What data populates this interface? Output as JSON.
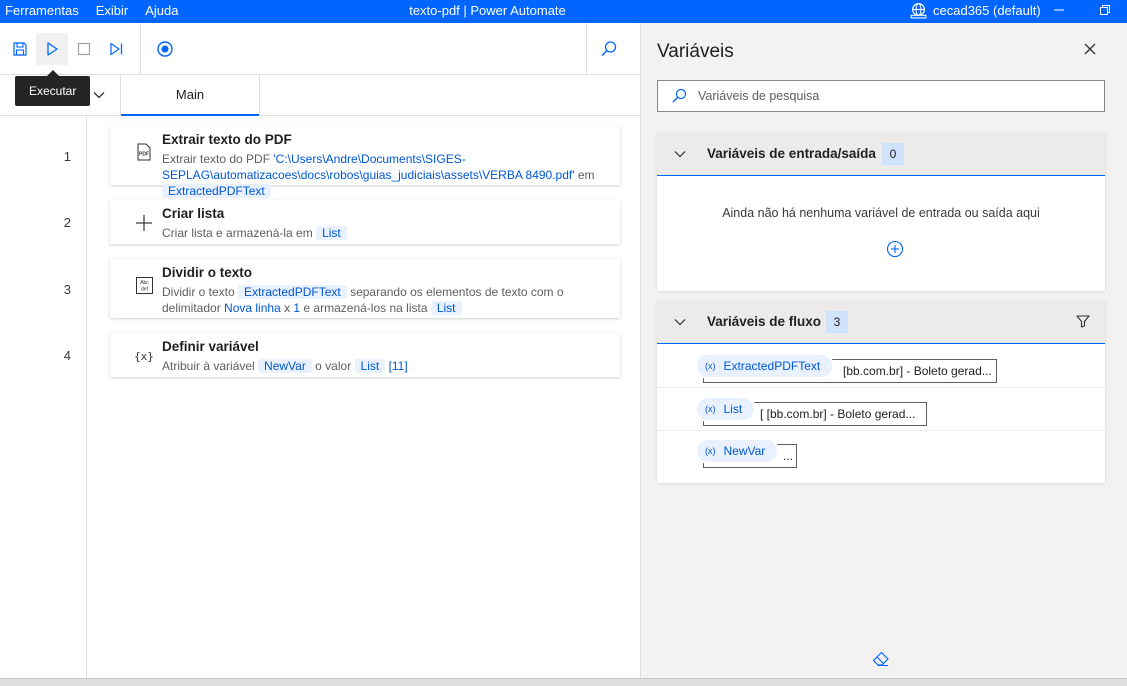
{
  "titlebar": {
    "menu": [
      "Ferramentas",
      "Exibir",
      "Ajuda"
    ],
    "title": "texto-pdf | Power Automate",
    "account": "cecad365 (default)"
  },
  "toolbar": {
    "tooltip": "Executar"
  },
  "tabs": {
    "main": "Main"
  },
  "actions": [
    {
      "line": "1",
      "title": "Extrair texto do PDF",
      "desc_prefix": "Extrair texto do PDF ",
      "path": "'C:\\Users\\Andre\\Documents\\SIGES-SEPLAG\\automatizacoes\\docs\\robos\\guias_judiciais\\assets\\VERBA 8490.pdf'",
      "desc_mid": " em ",
      "var": "ExtractedPDFText"
    },
    {
      "line": "2",
      "title": "Criar lista",
      "desc_prefix": "Criar lista e armazená-la em ",
      "var": "List"
    },
    {
      "line": "3",
      "title": "Dividir o texto",
      "desc_prefix": "Dividir o texto ",
      "var1": "ExtractedPDFText",
      "desc_mid1": " separando os elementos de texto com o delimitador ",
      "delim": "Nova linha",
      "desc_mid2": " x ",
      "count": "1",
      "desc_mid3": " e armazená-los na lista ",
      "var2": "List"
    },
    {
      "line": "4",
      "title": "Definir variável",
      "desc_prefix": "Atribuir à variável ",
      "var1": "NewVar",
      "desc_mid": " o valor ",
      "var2": "List",
      "index": "[11]"
    }
  ],
  "variables_panel": {
    "title": "Variáveis",
    "search_placeholder": "Variáveis de pesquisa",
    "io_section": {
      "title": "Variáveis de entrada/saída",
      "count": "0",
      "empty_message": "Ainda não há nenhuma variável de entrada ou saída aqui"
    },
    "flow_section": {
      "title": "Variáveis de fluxo",
      "count": "3",
      "variables": [
        {
          "name": "ExtractedPDFText",
          "value": "[bb.com.br] - Boleto gerad..."
        },
        {
          "name": "List",
          "value": "[   [bb.com.br] - Boleto gerad..."
        },
        {
          "name": "NewVar",
          "value": "..."
        }
      ]
    }
  },
  "colors": {
    "accent": "#0066ff",
    "token_bg": "#e8f1fd",
    "token_text": "#0057d4"
  }
}
